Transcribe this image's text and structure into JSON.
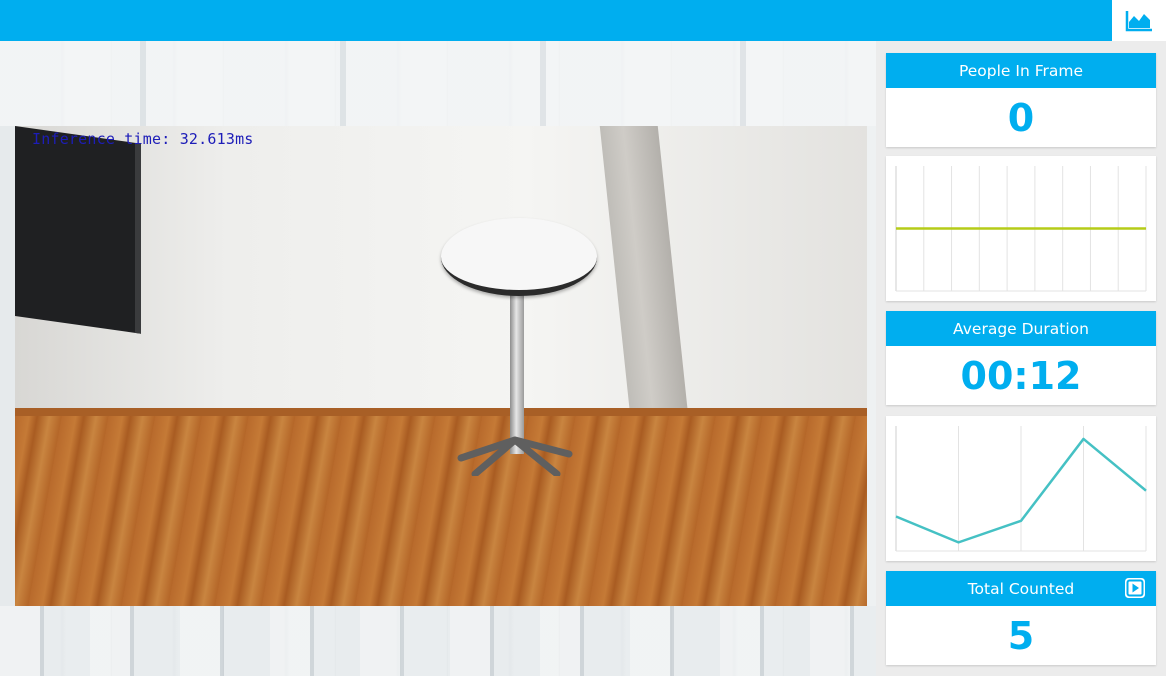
{
  "header": {
    "chart_toggle_icon": "area-chart-icon",
    "bar_color": "#00aeef"
  },
  "video": {
    "overlay_text": "Inference time: 32.613ms"
  },
  "stats": {
    "people_in_frame": {
      "label": "People In Frame",
      "value": "0"
    },
    "average_duration": {
      "label": "Average Duration",
      "value": "00:12"
    },
    "total_counted": {
      "label": "Total Counted",
      "value": "5",
      "action_icon": "play-icon"
    }
  },
  "chart_data": [
    {
      "type": "line",
      "x": [
        0,
        1,
        2,
        3,
        4,
        5,
        6,
        7,
        8,
        9
      ],
      "series": [
        {
          "values": [
            0,
            0,
            0,
            0,
            0,
            0,
            0,
            0,
            0,
            0
          ],
          "color": "#b5cc18"
        }
      ],
      "ylim": [
        -1,
        1
      ],
      "title": "",
      "xlabel": "",
      "ylabel": "",
      "grid": true
    },
    {
      "type": "line",
      "x": [
        0,
        1,
        2,
        3,
        4
      ],
      "series": [
        {
          "values": [
            8,
            2,
            7,
            26,
            14
          ],
          "color": "#45c1c4"
        }
      ],
      "ylim": [
        0,
        29
      ],
      "title": "",
      "xlabel": "",
      "ylabel": "",
      "grid": true
    }
  ],
  "colors": {
    "accent": "#00aeef",
    "value_text": "#00aeef"
  }
}
